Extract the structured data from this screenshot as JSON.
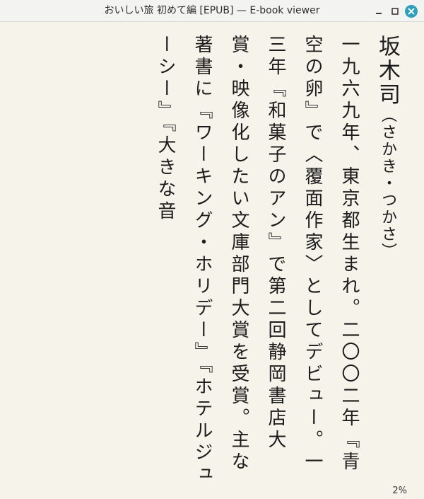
{
  "window": {
    "title": "おいしい旅 初めて編 [EPUB] — E-book viewer",
    "minimize_icon": "minimize-icon",
    "maximize_icon": "maximize-icon",
    "close_icon": "close-icon",
    "close_color": "#2e9fbd"
  },
  "book_page": {
    "author_name": "坂木司",
    "author_reading": "（さかき・つかさ）",
    "bio": "一九六九年、東京都生まれ。二〇〇二年『青空の卵』で〈覆面作家〉としてデビュー。一三年『和菓子のアン』で第二回静岡書店大賞・映像化したい文庫部門大賞を受賞。主な著書に『ワーキング・ホリデー』『ホテルジューシー』『大きな音"
  },
  "status": {
    "progress": "2%"
  }
}
